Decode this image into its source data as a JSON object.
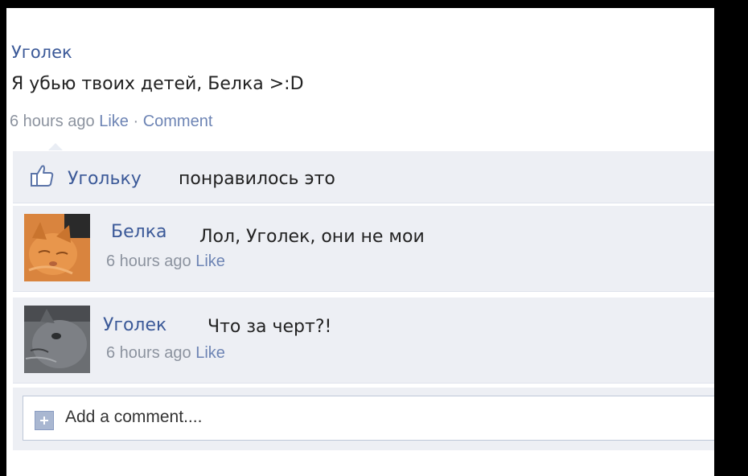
{
  "post": {
    "author": "Уголек",
    "text": "Я убью твоих детей, Белка >:D",
    "time": "6 hours ago",
    "like_label": "Like",
    "separator": " · ",
    "comment_label": "Comment"
  },
  "likes": {
    "who": "Угольку",
    "text": "понравилось это",
    "icon": "thumbs-up-icon"
  },
  "comments": [
    {
      "author": "Белка",
      "text": "Лол, Уголек, они не мои",
      "time": "6 hours ago",
      "like_label": "Like"
    },
    {
      "author": "Уголек",
      "text": "Что за черт?!",
      "time": "6 hours ago",
      "like_label": "Like"
    }
  ],
  "add_comment": {
    "placeholder": "Add a comment...."
  },
  "colors": {
    "link": "#3b5998",
    "meta": "#8c939f",
    "block_bg": "#edeff4"
  }
}
